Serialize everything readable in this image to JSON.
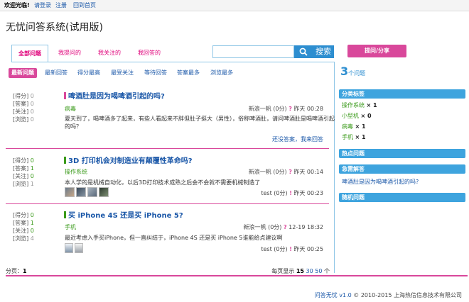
{
  "topbar": {
    "welcome": "欢迎光临!",
    "login": "请登录",
    "register": "注册",
    "home": "回到首页"
  },
  "site_title": "无忧问答系统(试用版)",
  "tabs": [
    {
      "label": "全部问题",
      "active": true
    },
    {
      "label": "我提问的",
      "active": false
    },
    {
      "label": "我关注的",
      "active": false
    },
    {
      "label": "我回答的",
      "active": false
    }
  ],
  "search": {
    "button_label": "搜索"
  },
  "ask_button": "提问/分享",
  "sort_options": [
    "最新问题",
    "最新回答",
    "得分最高",
    "最受关注",
    "等待回答",
    "答案最多",
    "浏览最多"
  ],
  "questions": [
    {
      "stats": [
        {
          "label": "[得分]",
          "value": "0"
        },
        {
          "label": "[答案]",
          "value": "0"
        },
        {
          "label": "[关注]",
          "value": "0"
        },
        {
          "label": "[浏览]",
          "value": "0"
        }
      ],
      "title": "啤酒肚是因为喝啤酒引起的吗?",
      "bar_color": "#d9489b",
      "tag": "病毒",
      "meta": {
        "user": "新浪一帆",
        "score": "(0分)",
        "when": "昨天 00:28"
      },
      "body": "夏天到了，喝啤酒多了起来，有些人看起来不胖但肚子挺大（男性），俗称啤酒肚，请问啤酒肚是喝啤酒引起的吗？",
      "extra": "还没答案，我来回答"
    },
    {
      "stats": [
        {
          "label": "[得分]",
          "value": "0"
        },
        {
          "label": "[答案]",
          "value": "1"
        },
        {
          "label": "[关注]",
          "value": "0"
        },
        {
          "label": "[浏览]",
          "value": "1"
        }
      ],
      "title": "3D 打印机会对制造业有颠覆性革命吗?",
      "bar_color": "#3a9a1a",
      "tag": "操作系统",
      "meta": {
        "user": "新浪一帆",
        "score": "(0分)",
        "when": "昨天 00:14"
      },
      "body": "本人学的是机械自动化，以后3D打印技术成熟之后会不会就不需要机械制造了",
      "meta2": {
        "user": "test",
        "score": "(0分)",
        "when": "昨天 00:23"
      }
    },
    {
      "stats": [
        {
          "label": "[得分]",
          "value": "0"
        },
        {
          "label": "[答案]",
          "value": "1"
        },
        {
          "label": "[关注]",
          "value": "0"
        },
        {
          "label": "[浏览]",
          "value": "4"
        }
      ],
      "title": "买 iPhone 4S 还是买 iPhone 5?",
      "bar_color": "#3a9a1a",
      "tag": "手机",
      "meta": {
        "user": "新浪一帆",
        "score": "(0分)",
        "when": "12-19 18:32"
      },
      "body": "最近考虑入手买iPhone，但一直纠结于，iPhone 4S 还是买 iPhone 5谁能给点建议啊",
      "meta2": {
        "user": "test",
        "score": "(0分)",
        "when": "昨天 00:25"
      }
    }
  ],
  "pager": {
    "label": "分页：",
    "page": "1"
  },
  "perpage": {
    "label": "每页显示",
    "current": "15",
    "opt1": "30",
    "opt2": "50",
    "unit": "个"
  },
  "sidebar": {
    "count": "3",
    "count_label": "个问题",
    "category_head": "分类标签",
    "categories": [
      {
        "name": "操作系统",
        "count": "× 1"
      },
      {
        "name": "小型机",
        "count": "× 0"
      },
      {
        "name": "病毒",
        "count": "× 1"
      },
      {
        "name": "手机",
        "count": "× 1"
      }
    ],
    "hot_head": "热点问题",
    "urgent_head": "急需解答",
    "urgent_link": "啤酒肚是因为喝啤酒引起的吗?",
    "random_head": "随机问题"
  },
  "footer": {
    "brand": "问答无忧 v1.0",
    "copyright": "© 2010-2015 上海热信信息技术有限公司"
  },
  "colors": {
    "accent_pink": "#d9489b",
    "accent_blue": "#2d8ed0",
    "tag_green": "#3a9a1a"
  }
}
